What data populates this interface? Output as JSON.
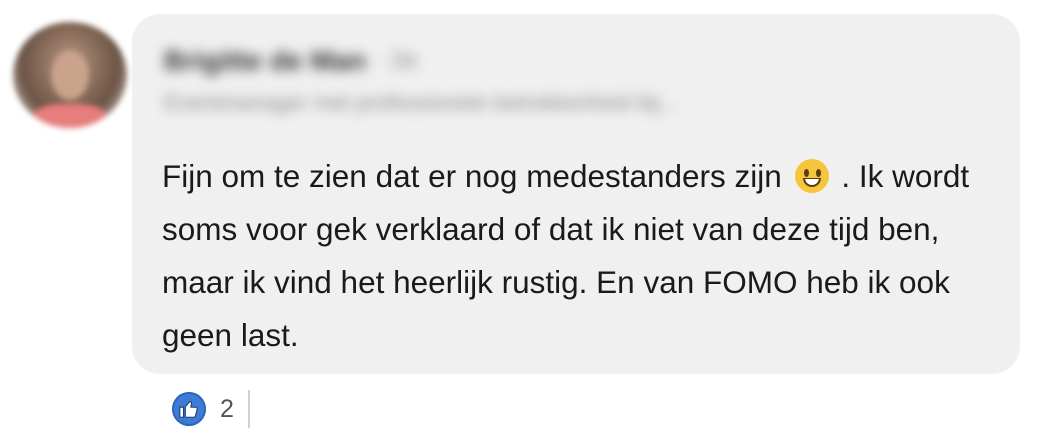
{
  "author": {
    "name": "Brigitte de Man",
    "meta": "· 2e",
    "headline": "Eventmanager met professionele betrokkenheid bij..."
  },
  "comment": {
    "text_part1": "Fijn om te zien dat er nog medestanders zijn",
    "emoji": "grinning-face-emoji",
    "text_part2": ". Ik wordt soms voor gek verklaard of dat ik niet van deze tijd ben, maar ik vind het heerlijk rustig. En van FOMO heb ik ook geen last."
  },
  "reactions": {
    "icon": "like-thumbs-up-icon",
    "count": "2"
  },
  "colors": {
    "bubble_bg": "#f0f0f0",
    "like_blue": "#3c7cd6",
    "text": "#1a1a1a"
  }
}
